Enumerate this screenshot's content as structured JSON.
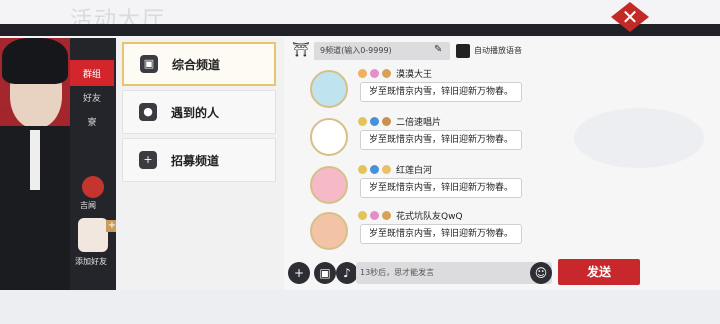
{
  "background": {
    "title": "活动大厅"
  },
  "close_icon": "close-icon",
  "sidebar": {
    "tabs": [
      {
        "label": "群组",
        "active": true
      },
      {
        "label": "好友",
        "active": false
      },
      {
        "label": "寮",
        "active": false
      }
    ],
    "gift_label": "吉闻",
    "add_friend_label": "添加好友"
  },
  "channels": [
    {
      "label": "综合频道",
      "icon": "chat-icon",
      "active": true
    },
    {
      "label": "遇到的人",
      "icon": "person-icon",
      "active": false
    },
    {
      "label": "招募频道",
      "icon": "plus-icon",
      "active": false
    }
  ],
  "chat": {
    "channel_placeholder": "9频道(输入0-9999)",
    "auto_voice_label": "自动播放语音",
    "messages": [
      {
        "name": "漠漠大王",
        "text": "岁至既惜京内雪，锌旧迎新万物春。"
      },
      {
        "name": "二倍速唱片",
        "text": "岁至既惜京内雪，锌旧迎新万物春。"
      },
      {
        "name": "红莲白河",
        "text": "岁至既惜京内雪，锌旧迎新万物春。"
      },
      {
        "name": "花式坑队友QwQ",
        "text": "岁至既惜京内雪，锌旧迎新万物春。"
      }
    ],
    "input_placeholder": "13秒后，思才能发言",
    "send_label": "发送"
  },
  "colors": {
    "accent": "#c8272c",
    "panel_dark": "#2a2b31",
    "gold": "#e6c56e"
  }
}
